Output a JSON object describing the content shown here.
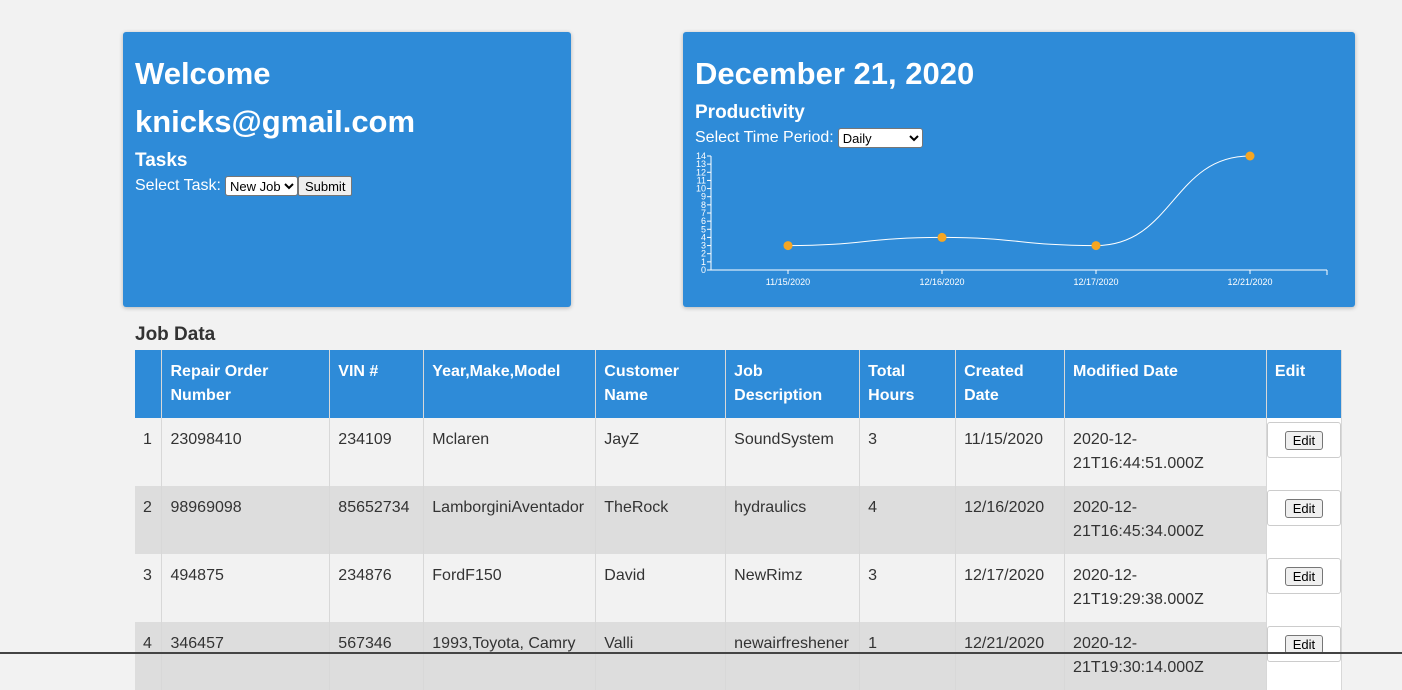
{
  "welcome": {
    "title": "Welcome",
    "email": "knicks@gmail.com",
    "tasks_heading": "Tasks",
    "select_label": "Select Task:",
    "select_value": "New Job",
    "submit_label": "Submit"
  },
  "productivity": {
    "date": "December 21, 2020",
    "heading": "Productivity",
    "period_label": "Select Time Period:",
    "period_value": "Daily"
  },
  "chart_data": {
    "type": "line",
    "categories": [
      "11/15/2020",
      "12/16/2020",
      "12/17/2020",
      "12/21/2020"
    ],
    "values": [
      3,
      4,
      3,
      14
    ],
    "ylim": [
      0,
      14
    ],
    "yticks": [
      "0",
      "1",
      "2",
      "3",
      "4",
      "5",
      "6",
      "7",
      "8",
      "9",
      "10",
      "11",
      "12",
      "13",
      "14"
    ],
    "line_color": "#ffffff",
    "point_color": "#f5a623"
  },
  "job_data": {
    "title": "Job Data",
    "headers": [
      "",
      "Repair Order Number",
      "VIN #",
      "Year,Make,Model",
      "Customer Name",
      "Job Description",
      "Total Hours",
      "Created Date",
      "Modified Date",
      "Edit"
    ],
    "rows": [
      [
        "1",
        "23098410",
        "234109",
        "Mclaren",
        "JayZ",
        "SoundSystem",
        "3",
        "11/15/2020",
        "2020-12-21T16:44:51.000Z"
      ],
      [
        "2",
        "98969098",
        "85652734",
        "LamborginiAventador",
        "TheRock",
        "hydraulics",
        "4",
        "12/16/2020",
        "2020-12-21T16:45:34.000Z"
      ],
      [
        "3",
        "494875",
        "234876",
        "FordF150",
        "David",
        "NewRimz",
        "3",
        "12/17/2020",
        "2020-12-21T19:29:38.000Z"
      ],
      [
        "4",
        "346457",
        "567346",
        "1993,Toyota, Camry",
        "Valli",
        "newairfreshener",
        "1",
        "12/21/2020",
        "2020-12-21T19:30:14.000Z"
      ]
    ],
    "edit_label": "Edit"
  },
  "colors": {
    "card_bg": "#2e8bd8",
    "page_bg": "#f2f2f2",
    "row_alt_bg": "#dddddd"
  }
}
